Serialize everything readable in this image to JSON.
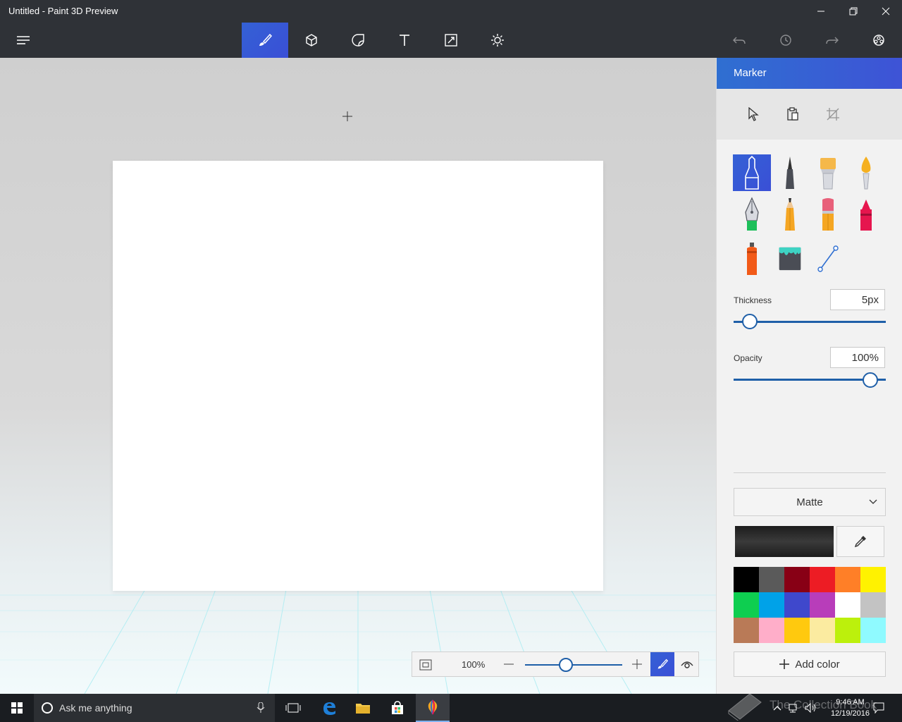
{
  "window": {
    "title": "Untitled - Paint 3D Preview",
    "minimize_icon": "minimize-icon",
    "maximize_icon": "restore-icon",
    "close_icon": "close-icon"
  },
  "toolbar": {
    "menu_icon": "hamburger-menu-icon",
    "tools": [
      {
        "name": "brushes",
        "icon": "brush-icon",
        "active": true
      },
      {
        "name": "3d-objects",
        "icon": "cube-icon",
        "active": false
      },
      {
        "name": "stickers",
        "icon": "sticker-icon",
        "active": false
      },
      {
        "name": "text",
        "icon": "text-icon",
        "active": false
      },
      {
        "name": "canvas",
        "icon": "resize-icon",
        "active": false
      },
      {
        "name": "effects",
        "icon": "sun-icon",
        "active": false
      }
    ],
    "right": [
      "undo-icon",
      "history-icon",
      "redo-icon",
      "remix-community-icon"
    ]
  },
  "panel": {
    "title": "Marker",
    "tools": [
      "select-icon",
      "paste-icon",
      "crop-icon"
    ],
    "brushes": [
      {
        "name": "marker",
        "active": true
      },
      {
        "name": "calligraphy-pen",
        "active": false
      },
      {
        "name": "oil-brush",
        "active": false
      },
      {
        "name": "watercolor",
        "active": false
      },
      {
        "name": "pixel-pen",
        "active": false
      },
      {
        "name": "pencil",
        "active": false
      },
      {
        "name": "eraser",
        "active": false
      },
      {
        "name": "crayon",
        "active": false
      },
      {
        "name": "spray-can",
        "active": false
      },
      {
        "name": "fill",
        "active": false
      },
      {
        "name": "line",
        "active": false
      }
    ],
    "thickness": {
      "label": "Thickness",
      "value": "5px",
      "level": 0.02
    },
    "opacity": {
      "label": "Opacity",
      "value": "100%",
      "level": 1.0
    },
    "finish": "Matte",
    "current_color": "#1c1c1c",
    "palette": [
      "#000000",
      "#5a5a5a",
      "#880015",
      "#ed1c24",
      "#ff7f27",
      "#fff200",
      "#0ece50",
      "#00a2e8",
      "#3f48cc",
      "#b83dba",
      "#ffffff",
      "#c3c3c3",
      "#b97a57",
      "#ffaec9",
      "#ffc90e",
      "#fbeba0",
      "#bcf00c",
      "#8ffaff"
    ],
    "add_color": "Add color"
  },
  "zoom": {
    "value": "100%",
    "level": 0.5
  },
  "taskbar": {
    "search_placeholder": "Ask me anything",
    "time": "9:46 AM",
    "date": "12/19/2016",
    "watermark": "The Collection Book"
  },
  "colors": {
    "accent": "#3461d5",
    "chrome": "#2f3237",
    "slider": "#1f5fa8"
  }
}
